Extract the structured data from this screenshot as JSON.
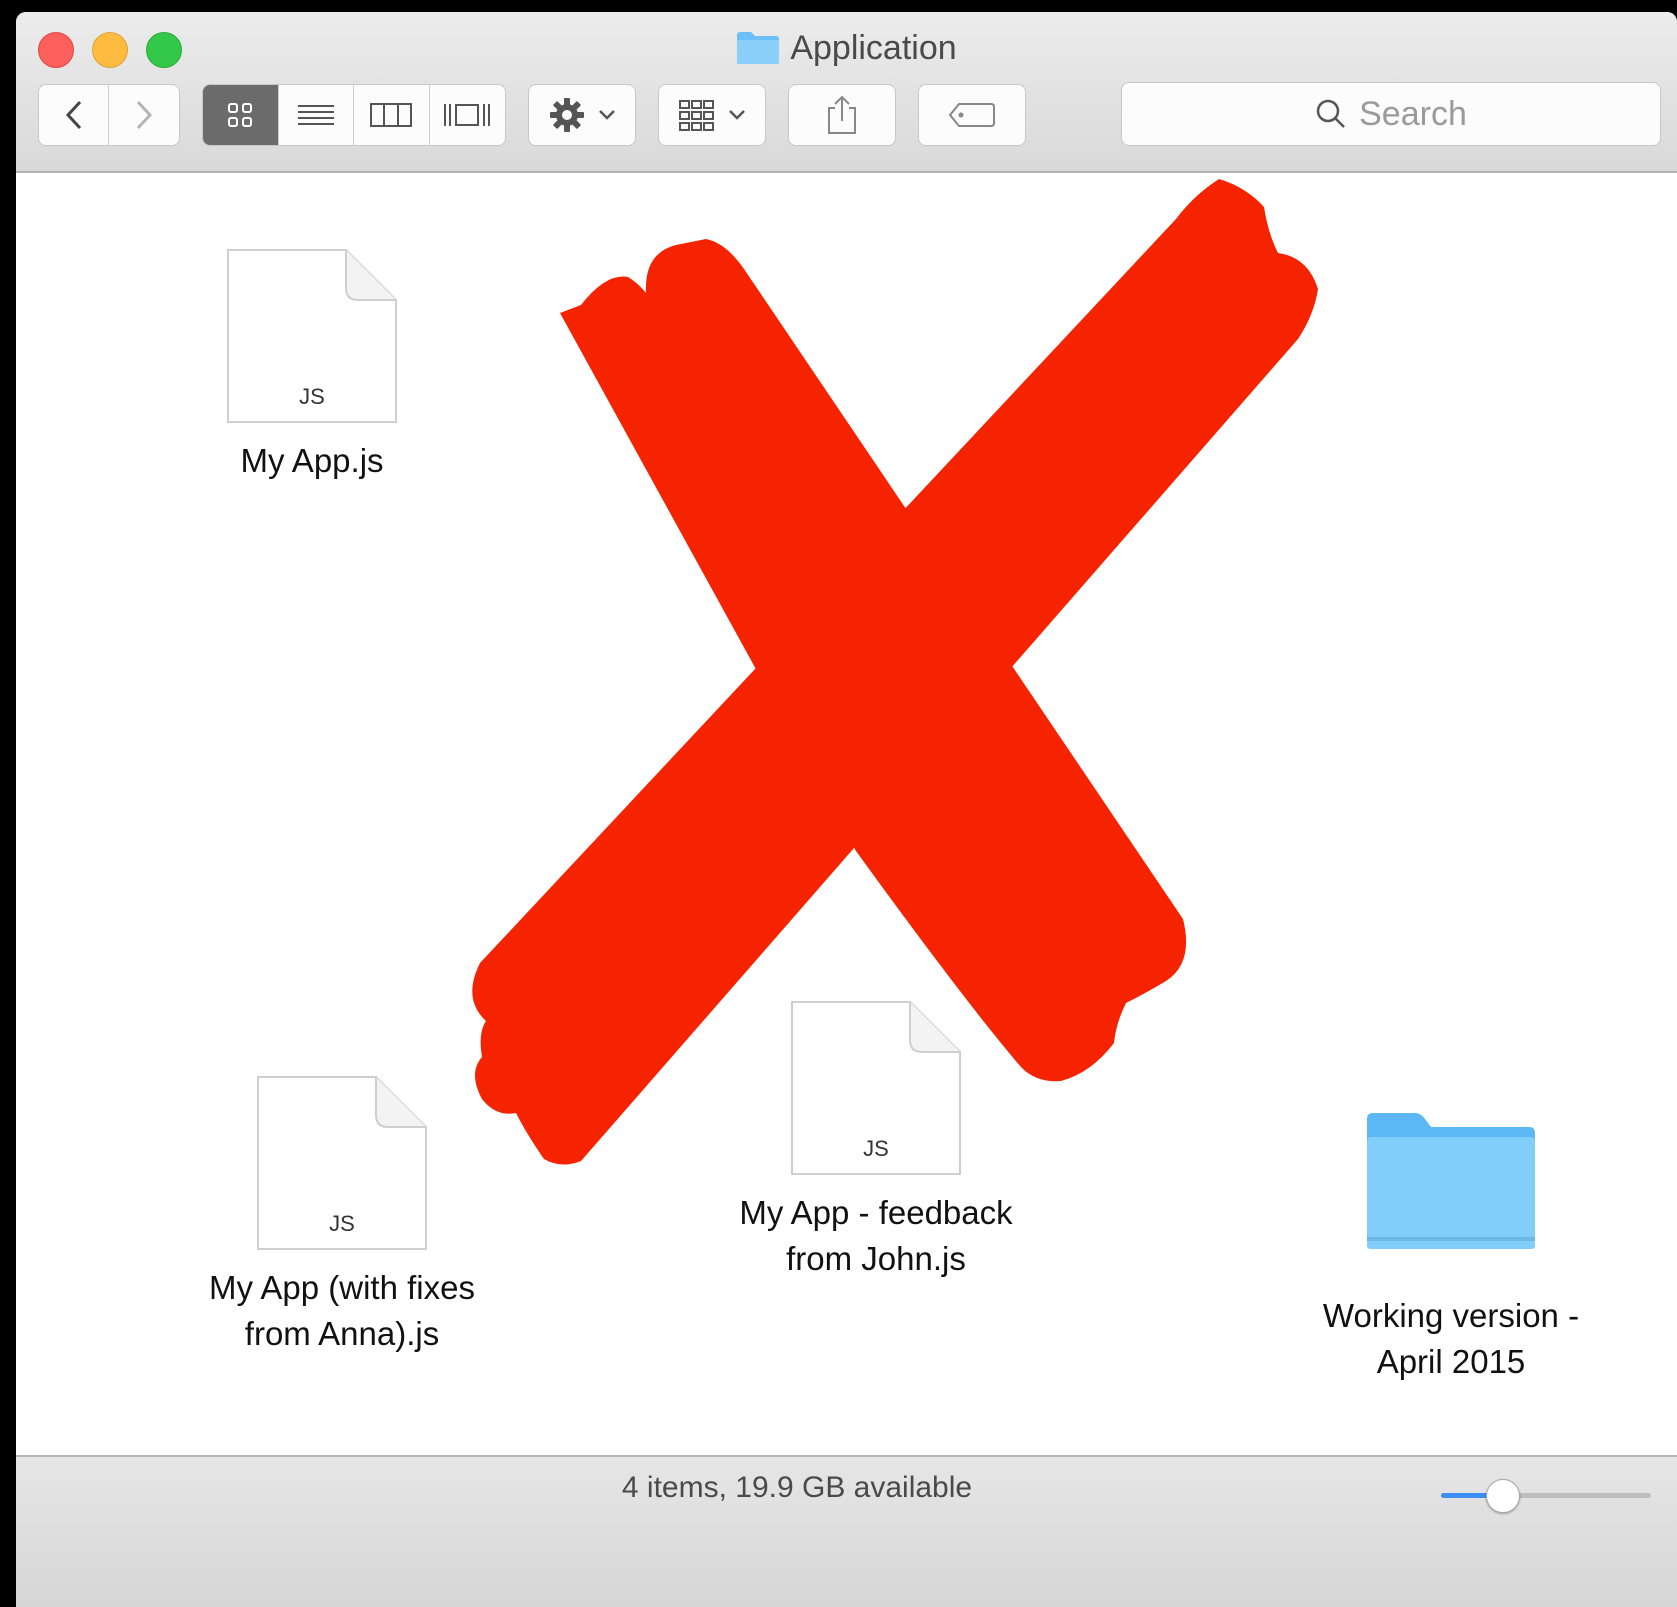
{
  "window": {
    "title": "Application"
  },
  "toolbar": {
    "search_placeholder": "Search"
  },
  "files": [
    {
      "name": "My App.js",
      "ext": "JS"
    },
    {
      "name_line1": "My App (with fixes",
      "name_line2": "from Anna).js",
      "ext": "JS"
    },
    {
      "name_line1": "My App - feedback",
      "name_line2": "from John.js",
      "ext": "JS"
    },
    {
      "name_line1": "Working version -",
      "name_line2": "April 2015",
      "kind": "folder"
    }
  ],
  "status": {
    "text": "4 items, 19.9 GB available",
    "zoom_level": 0.25
  },
  "colors": {
    "cross": "#f52300",
    "folder": "#5bb8f5"
  }
}
